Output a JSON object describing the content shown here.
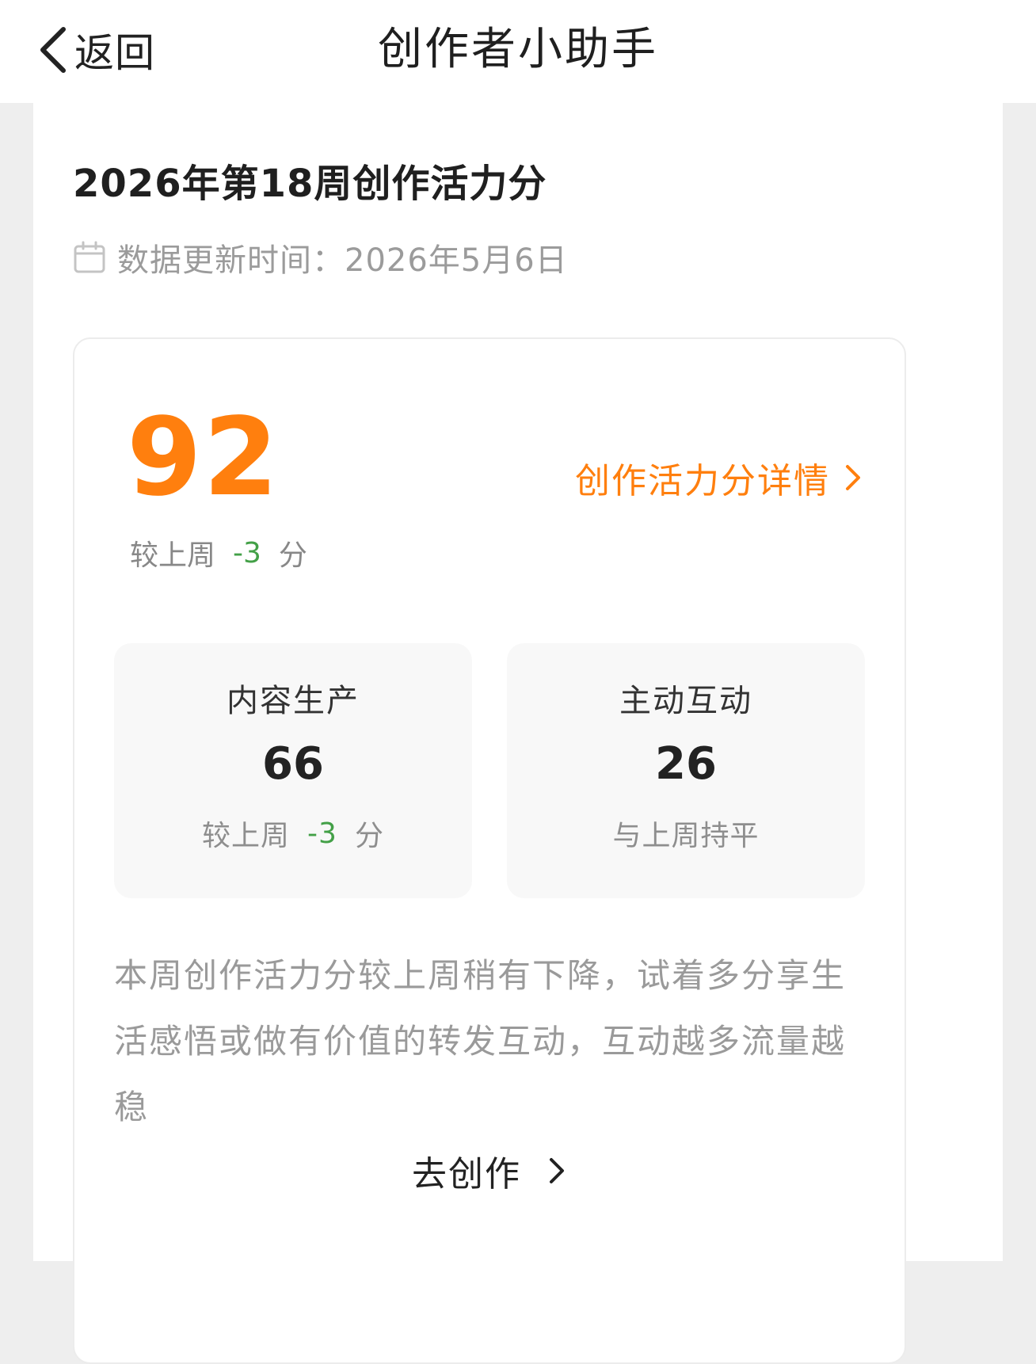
{
  "nav": {
    "back_label": "返回",
    "title": "创作者小助手"
  },
  "section": {
    "title": "2026年第18周创作活力分",
    "update_text": "数据更新时间：2026年5月6日"
  },
  "score": {
    "value": "92",
    "detail_label": "创作活力分详情",
    "delta_prefix": "较上周",
    "delta_value": "-3",
    "delta_suffix": "分"
  },
  "sub_scores": [
    {
      "title": "内容生产",
      "value": "66",
      "delta_prefix": "较上周",
      "delta_value": "-3",
      "delta_suffix": "分"
    },
    {
      "title": "主动互动",
      "value": "26",
      "status": "与上周持平"
    }
  ],
  "tip": "本周创作活力分较上周稍有下降，试着多分享生活感悟或做有价值的转发互动，互动越多流量越稳",
  "go_create_label": "去创作",
  "colors": {
    "accent": "#ff7f0e",
    "delta_negative": "#43a047",
    "text_primary": "#1f1f1f",
    "text_secondary": "#9b9b9b"
  },
  "icons": {
    "back": "chevron-left-icon",
    "calendar": "calendar-icon",
    "detail_arrow": "chevron-right-icon",
    "go_arrow": "chevron-right-icon"
  }
}
